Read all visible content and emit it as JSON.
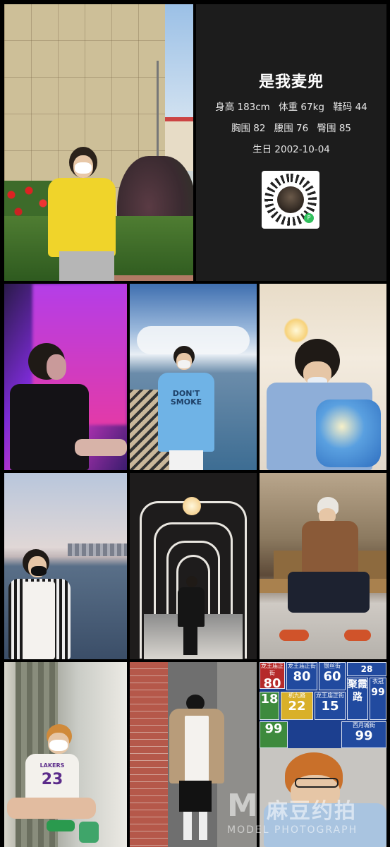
{
  "profile": {
    "name": "是我麦兜",
    "height": "身高 183cm",
    "weight": "体重 67kg",
    "shoe": "鞋码 44",
    "chest": "胸围 82",
    "waist": "腰围 76",
    "hips": "臀围 85",
    "birthday": "生日 2002-10-04",
    "qr_badge": "P"
  },
  "photos": {
    "sea_shirt_text": "DON'T SMOKE",
    "jersey_text": "LAKERS",
    "jersey_number": "23"
  },
  "signs": {
    "s1_name": "龙王庙正街",
    "s1_num": "80",
    "s2_name": "银丝街",
    "s2_num": "60",
    "s3_num": "28",
    "s4_name": "聚霞路",
    "s5_name": "机九路",
    "s5_num": "18",
    "s6_name": "",
    "s6_num": "22",
    "s7_name": "龙王庙正街",
    "s7_num": "15",
    "s8_name": "衣冠",
    "s8_num": "99",
    "s9_name": "西月城街",
    "s9_num": "99"
  },
  "watermark": {
    "mark": "M",
    "cn": "麻豆约拍",
    "en": "MODEL PHOTOGRAPH"
  },
  "colors": {
    "background": "#000000",
    "panel": "#1c1c1c",
    "qr_badge": "#2fbf5b"
  }
}
